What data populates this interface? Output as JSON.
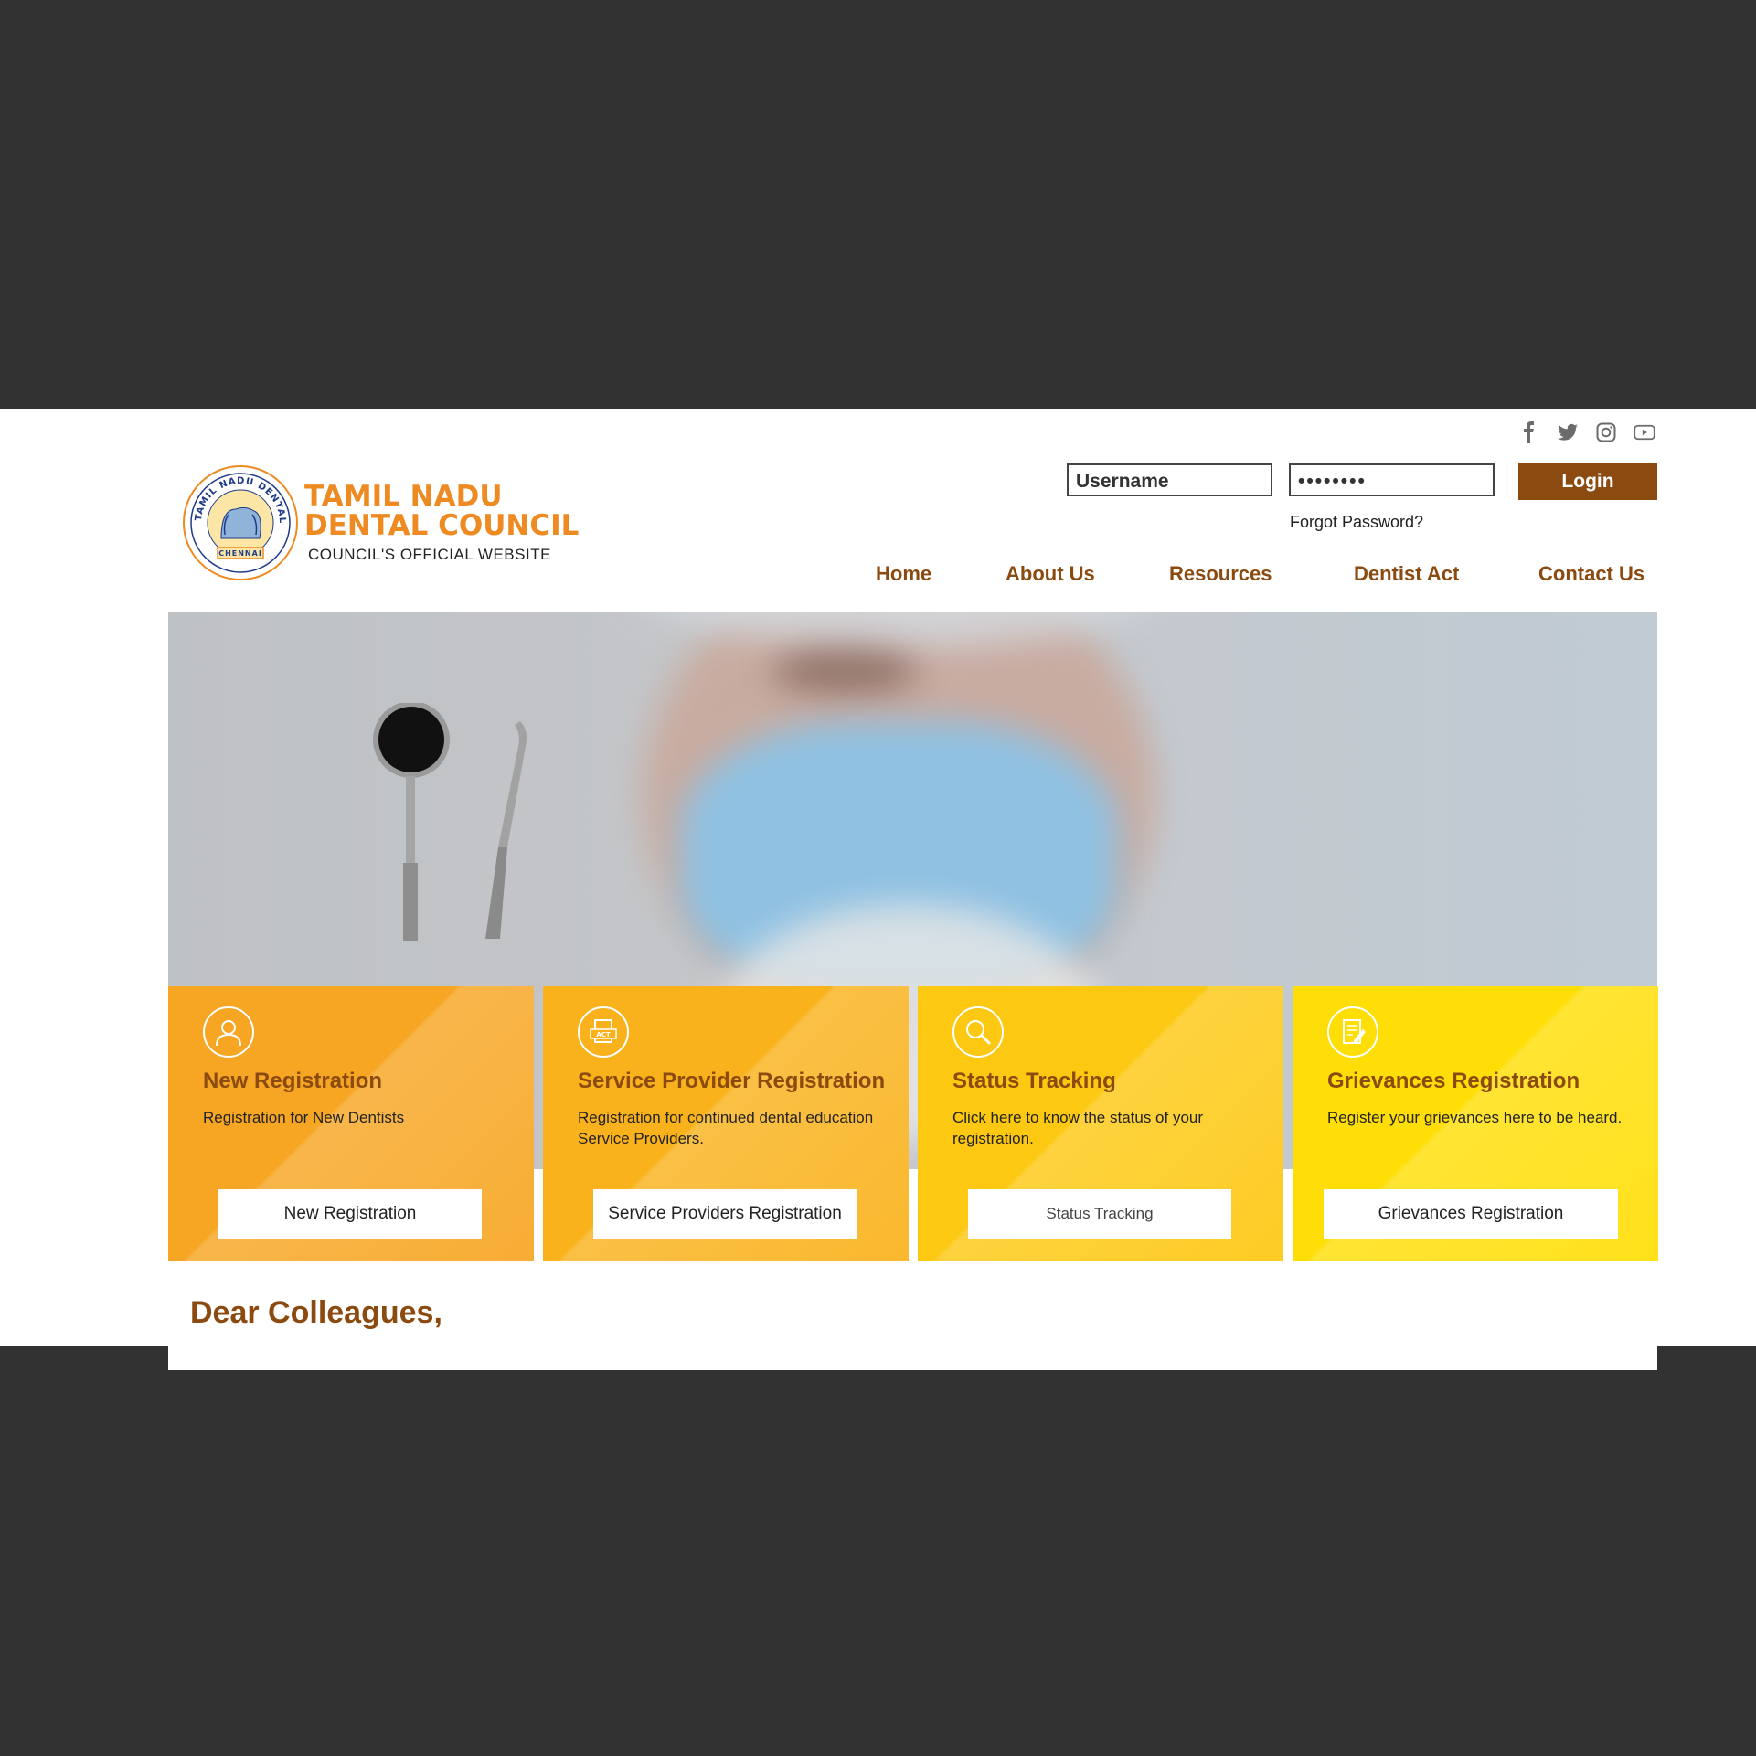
{
  "social": {
    "icons": [
      "facebook-icon",
      "twitter-icon",
      "instagram-icon",
      "youtube-icon"
    ]
  },
  "header": {
    "logo_text": "TAMIL NADU DENTAL COUNCIL CHENNAI",
    "brand_line1": "TAMIL NADU",
    "brand_line2": "DENTAL COUNCIL",
    "tagline": "COUNCIL'S OFFICIAL WEBSITE"
  },
  "login": {
    "username_placeholder": "Username",
    "password_value": "••••••••",
    "login_label": "Login",
    "forgot_label": "Forgot Password?"
  },
  "nav": {
    "items": [
      "Home",
      "About Us",
      "Resources",
      "Dentist Act",
      "Contact Us"
    ]
  },
  "cards": [
    {
      "title": "New Registration",
      "desc": "Registration for New Dentists",
      "button": "New Registration",
      "icon": "user-icon",
      "color": "#f7a623"
    },
    {
      "title": "Service Provider Registration",
      "desc": "Registration for continued dental education Service Providers.",
      "button": "Service Providers Registration",
      "icon": "act-document-icon",
      "color": "#f9b21c"
    },
    {
      "title": "Status Tracking",
      "desc": "Click here to know the status of your registration.",
      "button": "Status Tracking",
      "icon": "search-icon",
      "color": "#fdc812"
    },
    {
      "title": "Grievances Registration",
      "desc": "Register your grievances here to be heard.",
      "button": "Grievances Registration",
      "icon": "edit-document-icon",
      "color": "#ffde07"
    }
  ],
  "greeting": "Dear Colleagues,",
  "colors": {
    "accent": "#8b4a0f",
    "brand_orange": "#ee8a22",
    "frame": "#333233"
  }
}
